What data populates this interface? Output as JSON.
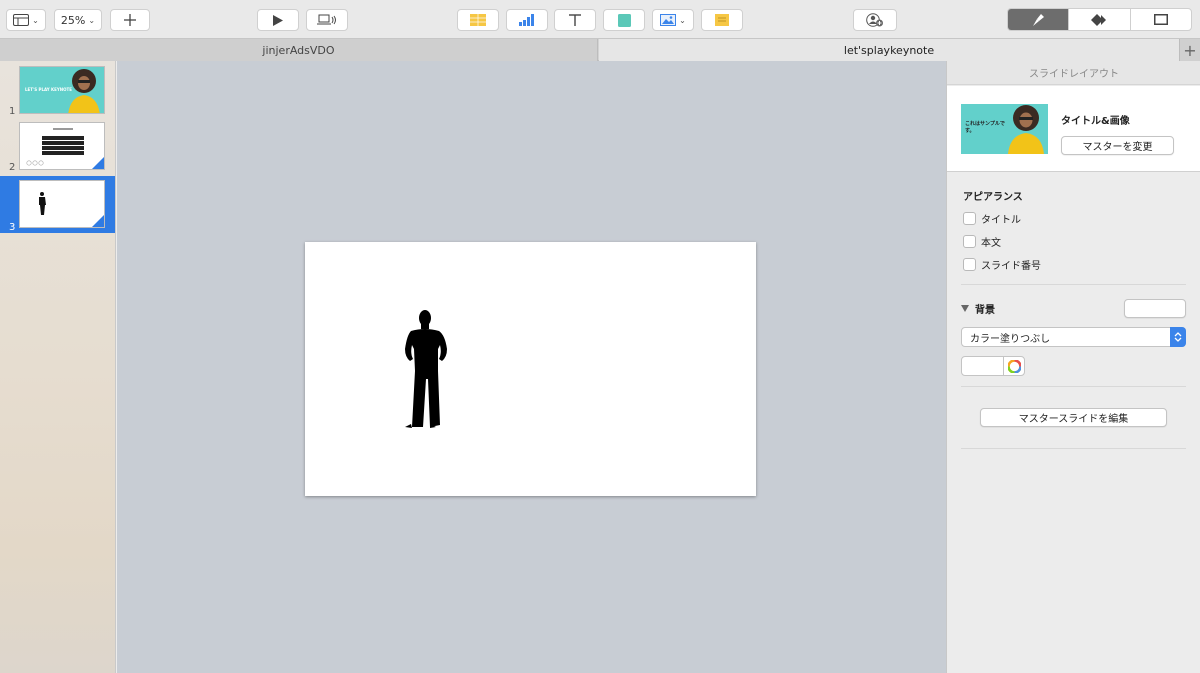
{
  "toolbar": {
    "zoom_value": "25%"
  },
  "tabs": [
    {
      "label": "jinjerAdsVDO"
    },
    {
      "label": "let'splaykeynote"
    }
  ],
  "tab_add": "+",
  "slides": [
    {
      "number": "1",
      "thumb_title": "LET'S PLAY KEYNOTE"
    },
    {
      "number": "2"
    },
    {
      "number": "3"
    }
  ],
  "selected_slide": "3",
  "inspector": {
    "header": "スライドレイアウト",
    "layout_name": "タイトル&画像",
    "layout_thumb_text": "これはサンプルです。",
    "change_master_button": "マスターを変更",
    "appearance_title": "アピアランス",
    "appearance_options": [
      "タイトル",
      "本文",
      "スライド番号"
    ],
    "background_title": "背景",
    "fill_select_value": "カラー塗りつぶし",
    "edit_master_button": "マスタースライドを編集"
  },
  "colors": {
    "accent": "#2f7be3",
    "thumb_teal": "#62d0cb",
    "canvas_bg": "#c8cdd4"
  }
}
